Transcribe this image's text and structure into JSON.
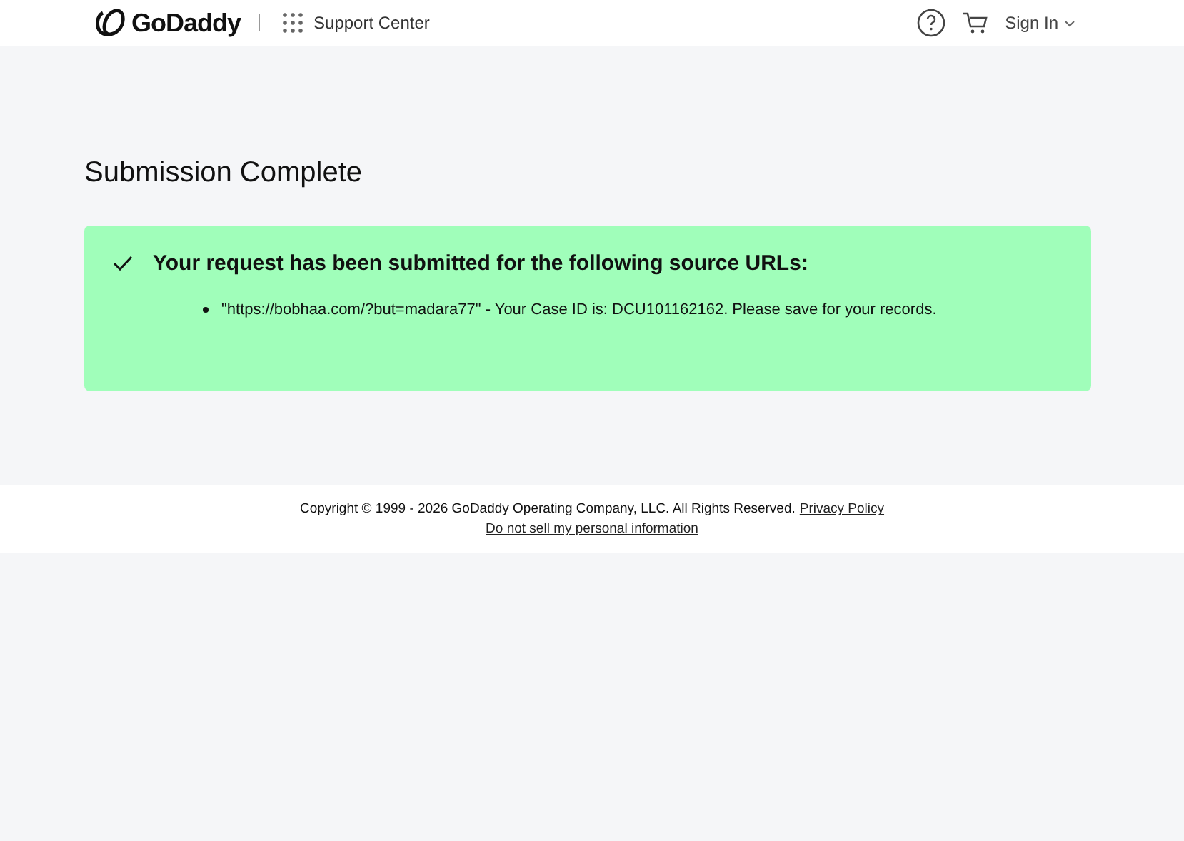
{
  "header": {
    "brand": "GoDaddy",
    "section": "Support Center",
    "sign_in": "Sign In"
  },
  "title": "Submission Complete",
  "alert": {
    "heading": "Your request has been submitted for the following source URLs:",
    "items": [
      "\"https://bobhaa.com/?but=madara77\" - Your Case ID is: DCU101162162. Please save for your records."
    ]
  },
  "footer": {
    "copyright": "Copyright © 1999 - 2026 GoDaddy Operating Company, LLC. All Rights Reserved.",
    "privacy": "Privacy Policy",
    "do_not_sell": "Do not sell my personal information"
  }
}
